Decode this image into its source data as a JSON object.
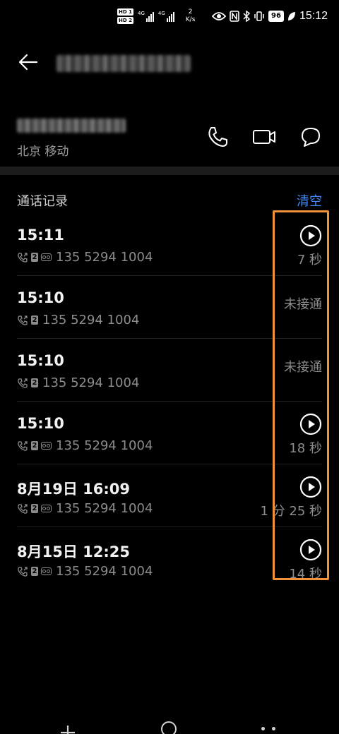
{
  "status_bar": {
    "hd1": "HD 1",
    "hd2": "HD 2",
    "sig1": "4G",
    "sig2": "4G",
    "speed_value": "2",
    "speed_unit": "K/s",
    "battery": "96",
    "time": "15:12"
  },
  "contact": {
    "location": "北京 移动"
  },
  "call_log": {
    "title": "通话记录",
    "clear_label": "清空",
    "entries": [
      {
        "time": "15:11",
        "number": "135 5294 1004",
        "status": "7 秒",
        "has_recording": true
      },
      {
        "time": "15:10",
        "number": "135 5294 1004",
        "status": "未接通",
        "has_recording": false
      },
      {
        "time": "15:10",
        "number": "135 5294 1004",
        "status": "未接通",
        "has_recording": false
      },
      {
        "time": "15:10",
        "number": "135 5294 1004",
        "status": "18 秒",
        "has_recording": true
      },
      {
        "time": "8月19日 16:09",
        "number": "135 5294 1004",
        "status": "1 分 25 秒",
        "has_recording": true
      },
      {
        "time": "8月15日 12:25",
        "number": "135 5294 1004",
        "status": "14 秒",
        "has_recording": true
      }
    ]
  },
  "colors": {
    "accent": "#3f8cff",
    "highlight": "#f0923a",
    "secondary_text": "#8c8c8c"
  },
  "icons": {
    "back": "back-arrow-icon",
    "call": "phone-icon",
    "video": "video-camera-icon",
    "message": "message-bubble-icon",
    "play": "play-icon"
  }
}
